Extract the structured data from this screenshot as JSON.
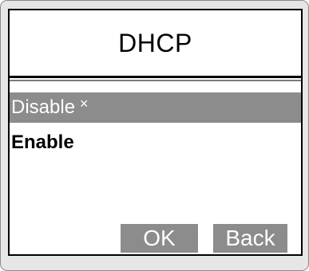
{
  "screen": {
    "title": "DHCP"
  },
  "options": [
    {
      "label": "Disable",
      "selected": true,
      "mark": "×"
    },
    {
      "label": "Enable",
      "selected": false
    }
  ],
  "softkeys": {
    "ok_label": "OK",
    "back_label": "Back"
  },
  "colors": {
    "selection": "#8c8c8c",
    "frame": "#e6e6e6",
    "screen_background": "#ffffff",
    "text": "#000000"
  }
}
